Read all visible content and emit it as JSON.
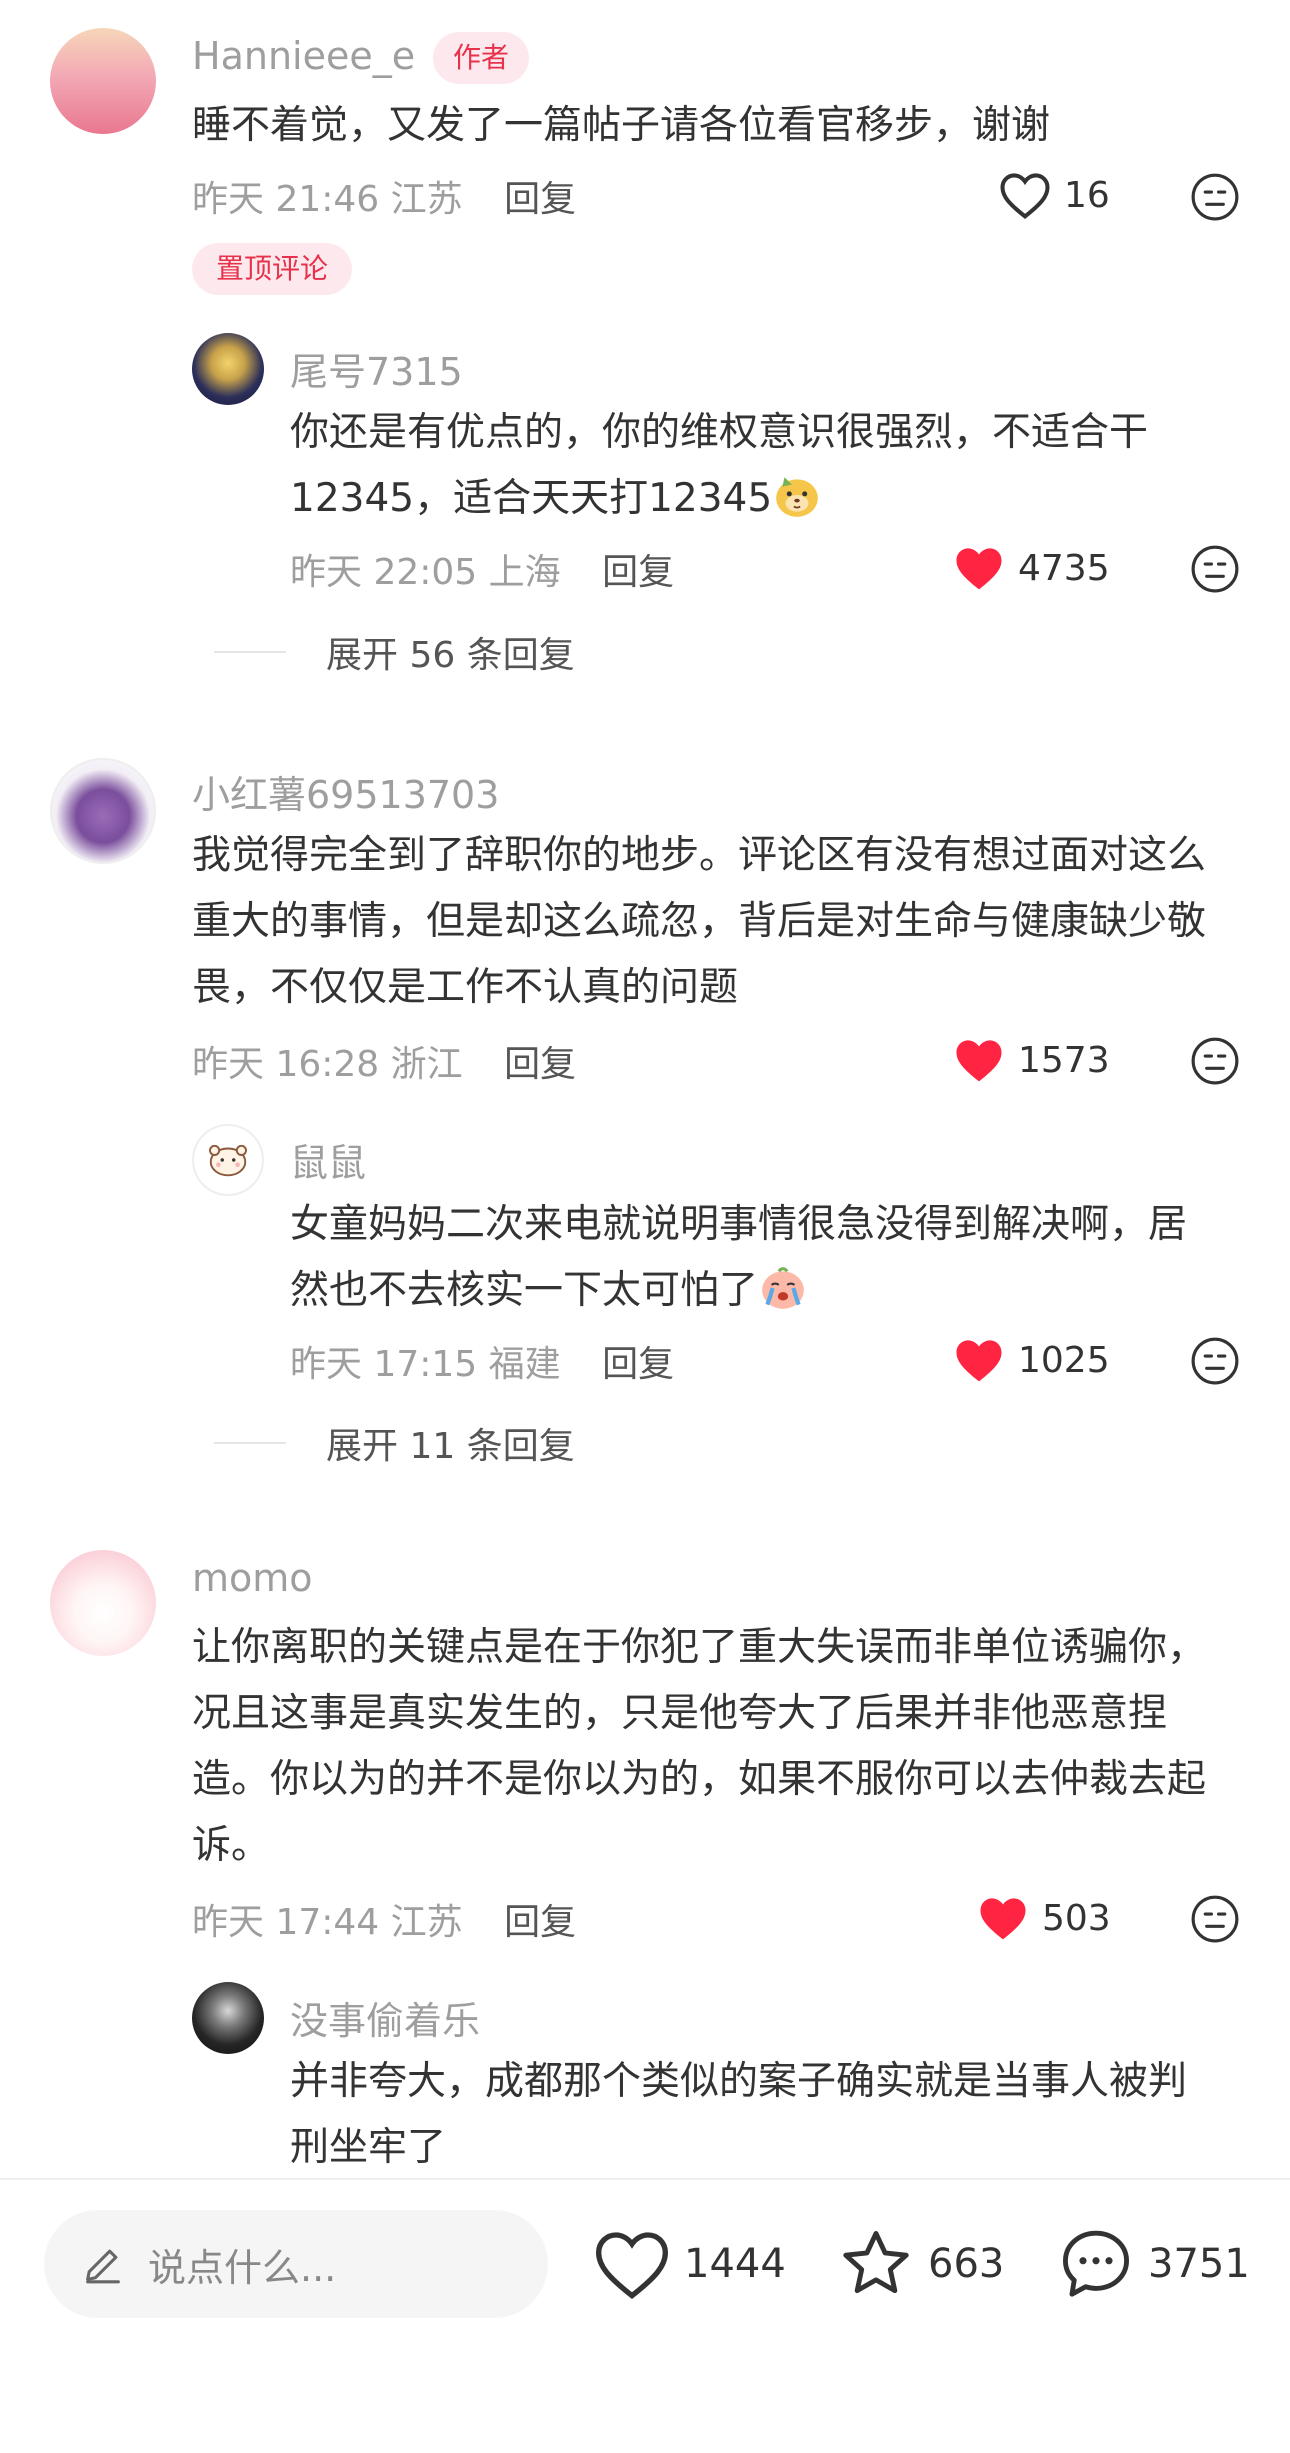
{
  "comments": [
    {
      "user": "Hannieee_e",
      "author_badge": "作者",
      "text": "睡不着觉，又发了一篇帖子请各位看官移步，谢谢",
      "time": "昨天 21:46",
      "location": "江苏",
      "reply_label": "回复",
      "likes": "16",
      "liked": false,
      "pinned_badge": "置顶评论",
      "replies": [
        {
          "user": "尾号7315",
          "text": "你还是有优点的，你的维权意识很强烈，不适合干12345，适合天天打12345",
          "time": "昨天 22:05",
          "location": "上海",
          "reply_label": "回复",
          "likes": "4735",
          "liked": true
        }
      ],
      "expand_label": "展开 56 条回复"
    },
    {
      "user": "小红薯69513703",
      "text": "我觉得完全到了辞职你的地步。评论区有没有想过面对这么重大的事情，但是却这么疏忽，背后是对生命与健康缺少敬畏，不仅仅是工作不认真的问题",
      "time": "昨天 16:28",
      "location": "浙江",
      "reply_label": "回复",
      "likes": "1573",
      "liked": true,
      "replies": [
        {
          "user": "鼠鼠",
          "text": "女童妈妈二次来电就说明事情很急没得到解决啊，居然也不去核实一下太可怕了",
          "time": "昨天 17:15",
          "location": "福建",
          "reply_label": "回复",
          "likes": "1025",
          "liked": true
        }
      ],
      "expand_label": "展开 11 条回复"
    },
    {
      "user": "momo",
      "text": "让你离职的关键点是在于你犯了重大失误而非单位诱骗你，况且这事是真实发生的，只是他夸大了后果并非他恶意捏造。你以为的并不是你以为的，如果不服你可以去仲裁去起诉。",
      "time": "昨天 17:44",
      "location": "江苏",
      "reply_label": "回复",
      "likes": "503",
      "liked": true,
      "replies": [
        {
          "user": "没事偷着乐",
          "text": "并非夸大，成都那个类似的案子确实就是当事人被判刑坐牢了"
        }
      ]
    }
  ],
  "bottom_bar": {
    "input_placeholder": "说点什么...",
    "likes": "1444",
    "collects": "663",
    "comments": "3751"
  },
  "colors": {
    "accent_red": "#ff2442",
    "badge_bg": "#fde9ed",
    "badge_text": "#e8314b",
    "meta_gray": "#9e9e9e"
  },
  "icons": [
    "heart-outline-icon",
    "heart-filled-icon",
    "emoji-neutral-icon",
    "pencil-icon",
    "star-outline-icon",
    "comment-bubble-icon"
  ]
}
